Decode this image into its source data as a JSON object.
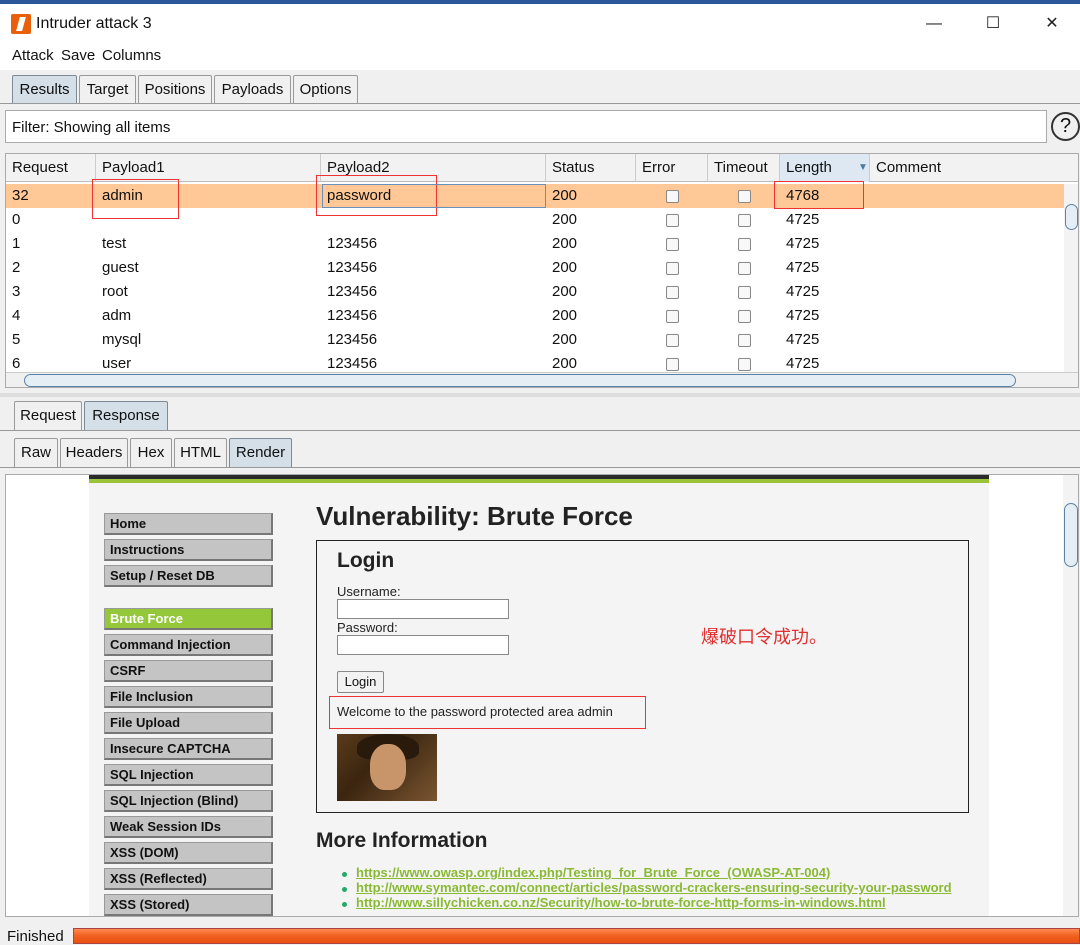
{
  "window": {
    "title": "Intruder attack 3",
    "minimize": "—",
    "maximize": "☐",
    "close": "✕"
  },
  "menu": [
    "Attack",
    "Save",
    "Columns"
  ],
  "main_tabs": [
    {
      "label": "Results",
      "selected": true
    },
    {
      "label": "Target",
      "selected": false
    },
    {
      "label": "Positions",
      "selected": false
    },
    {
      "label": "Payloads",
      "selected": false
    },
    {
      "label": "Options",
      "selected": false
    }
  ],
  "filter": {
    "text": "Filter: Showing all items",
    "help": "?"
  },
  "table": {
    "columns": [
      "Request",
      "Payload1",
      "Payload2",
      "Status",
      "Error",
      "Timeout",
      "Length",
      "Comment"
    ],
    "sort_indicator": "▼",
    "rows": [
      {
        "request": "32",
        "payload1": "admin",
        "payload2": "password",
        "status": "200",
        "length": "4768",
        "selected": true
      },
      {
        "request": "0",
        "payload1": "",
        "payload2": "",
        "status": "200",
        "length": "4725"
      },
      {
        "request": "1",
        "payload1": "test",
        "payload2": "123456",
        "status": "200",
        "length": "4725"
      },
      {
        "request": "2",
        "payload1": "guest",
        "payload2": "123456",
        "status": "200",
        "length": "4725"
      },
      {
        "request": "3",
        "payload1": "root",
        "payload2": "123456",
        "status": "200",
        "length": "4725"
      },
      {
        "request": "4",
        "payload1": "adm",
        "payload2": "123456",
        "status": "200",
        "length": "4725"
      },
      {
        "request": "5",
        "payload1": "mysql",
        "payload2": "123456",
        "status": "200",
        "length": "4725"
      },
      {
        "request": "6",
        "payload1": "user",
        "payload2": "123456",
        "status": "200",
        "length": "4725"
      }
    ]
  },
  "reqres_tabs": [
    {
      "label": "Request",
      "selected": false
    },
    {
      "label": "Response",
      "selected": true
    }
  ],
  "view_tabs": [
    {
      "label": "Raw",
      "selected": false
    },
    {
      "label": "Headers",
      "selected": false
    },
    {
      "label": "Hex",
      "selected": false
    },
    {
      "label": "HTML",
      "selected": false
    },
    {
      "label": "Render",
      "selected": true
    }
  ],
  "render": {
    "sidebar": [
      "Home",
      "Instructions",
      "Setup / Reset DB",
      "Brute Force",
      "Command Injection",
      "CSRF",
      "File Inclusion",
      "File Upload",
      "Insecure CAPTCHA",
      "SQL Injection",
      "SQL Injection (Blind)",
      "Weak Session IDs",
      "XSS (DOM)",
      "XSS (Reflected)",
      "XSS (Stored)"
    ],
    "active_item": "Brute Force",
    "title": "Vulnerability: Brute Force",
    "login": {
      "heading": "Login",
      "username_label": "Username:",
      "password_label": "Password:",
      "button": "Login",
      "welcome": "Welcome to the password protected area admin"
    },
    "more_heading": "More Information",
    "links": [
      "https://www.owasp.org/index.php/Testing_for_Brute_Force_(OWASP-AT-004)",
      "http://www.symantec.com/connect/articles/password-crackers-ensuring-security-your-password",
      "http://www.sillychicken.co.nz/Security/how-to-brute-force-http-forms-in-windows.html"
    ]
  },
  "annotation": "爆破口令成功。",
  "status": {
    "text": "Finished"
  },
  "colors": {
    "selected_row": "#ffc896",
    "highlight_box": "#e33333",
    "active_nav": "#94c83a",
    "progress": "#f06020"
  }
}
